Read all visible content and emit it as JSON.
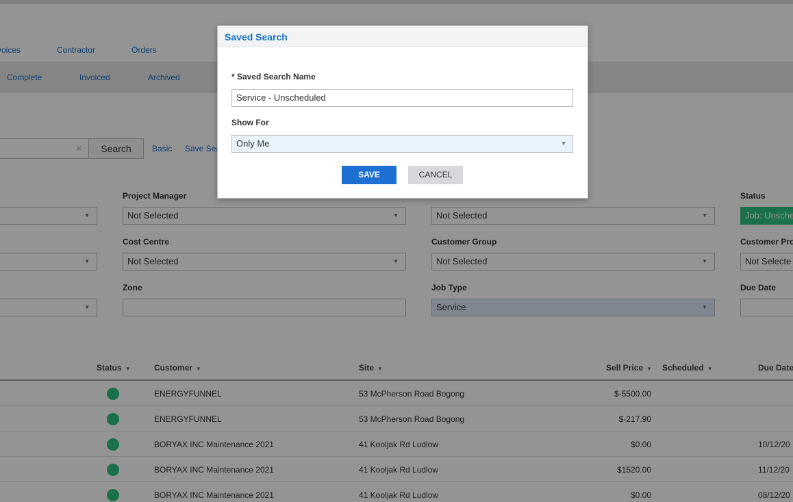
{
  "nav": {
    "top_tabs": [
      "voices",
      "Contractor",
      "Orders"
    ],
    "status_tabs": [
      "Complete",
      "Invoiced",
      "Archived"
    ]
  },
  "search": {
    "button_label": "Search",
    "clear_glyph": "×",
    "basic_link": "Basic",
    "save_link": "Save Sea"
  },
  "filters": {
    "project_manager": {
      "label": "Project Manager",
      "value": "Not Selected"
    },
    "cost_centre": {
      "label": "Cost Centre",
      "value": "Not Selected"
    },
    "zone": {
      "label": "Zone",
      "value": ""
    },
    "technician_value": "Not Selected",
    "customer_group": {
      "label": "Customer Group",
      "value": "Not Selected"
    },
    "job_type": {
      "label": "Job Type",
      "value": "Service"
    },
    "status": {
      "label": "Status",
      "value": "Job: Unsche"
    },
    "customer_profile": {
      "label": "Customer Prof",
      "value": "Not Selecte"
    },
    "due_date": {
      "label": "Due Date",
      "value": ""
    }
  },
  "table": {
    "headers": {
      "status": "Status",
      "customer": "Customer",
      "site": "Site",
      "sell_price": "Sell Price",
      "scheduled": "Scheduled",
      "due_date": "Due Date"
    },
    "rows": [
      {
        "customer": "ENERGYFUNNEL",
        "site": "53 McPherson Road Bogong",
        "sell_price": "$-5500.00",
        "due_date": ""
      },
      {
        "customer": "ENERGYFUNNEL",
        "site": "53 McPherson Road Bogong",
        "sell_price": "$-217.90",
        "due_date": ""
      },
      {
        "customer": "BORYAX INC Maintenance 2021",
        "site": "41 Kooljak Rd Ludlow",
        "sell_price": "$0.00",
        "due_date": "10/12/20"
      },
      {
        "customer": "BORYAX INC Maintenance 2021",
        "site": "41 Kooljak Rd Ludlow",
        "sell_price": "$1520.00",
        "due_date": "11/12/20"
      },
      {
        "customer": "BORYAX INC Maintenance 2021",
        "site": "41 Kooljak Rd Ludlow",
        "sell_price": "$0.00",
        "due_date": "08/12/20"
      }
    ]
  },
  "modal": {
    "title": "Saved Search",
    "name_label": "* Saved Search Name",
    "name_value": "Service - Unscheduled",
    "show_for_label": "Show For",
    "show_for_value": "Only Me",
    "save_label": "SAVE",
    "cancel_label": "CANCEL"
  },
  "icons": {
    "dropdown": "chevron-down-icon",
    "clear": "close-icon",
    "sort": "sort-down-icon"
  },
  "colors": {
    "accent": "#1a6fc4",
    "save_button": "#1d6fd1",
    "status_green": "#2ec27e",
    "overlay": "rgba(0,0,0,0.42)"
  }
}
